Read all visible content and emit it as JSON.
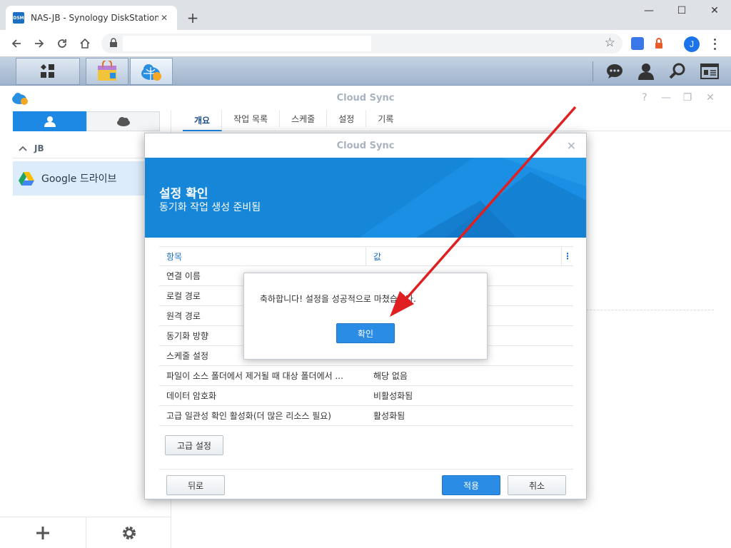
{
  "browser": {
    "tab_title": "NAS-JB - Synology DiskStation",
    "favicon_text": "DSM",
    "new_tab": "+",
    "avatar_letter": "J"
  },
  "app": {
    "title": "Cloud Sync",
    "sidebar": {
      "group_label": "JB",
      "item_label": "Google 드라이브"
    },
    "tabs": [
      "개요",
      "작업 목록",
      "스케줄",
      "설정",
      "기록"
    ]
  },
  "dialog": {
    "title": "Cloud Sync",
    "banner_title": "설정 확인",
    "banner_subtitle": "동기화 작업 생성 준비됨",
    "columns": {
      "item": "항목",
      "value": "값",
      "more": "⋮"
    },
    "rows": [
      {
        "item": "연결 이름",
        "value": ""
      },
      {
        "item": "로컬 경로",
        "value": ""
      },
      {
        "item": "원격 경로",
        "value": ""
      },
      {
        "item": "동기화 방향",
        "value": ""
      },
      {
        "item": "스케줄 설정",
        "value": ""
      },
      {
        "item": "파일이 소스 폴더에서 제거될 때 대상 폴더에서 ...",
        "value": "해당 없음"
      },
      {
        "item": "데이터 암호화",
        "value": "비활성화됨"
      },
      {
        "item": "고급 일관성 확인 활성화(더 많은 리소스 필요)",
        "value": "활성화됨"
      }
    ],
    "advanced_button": "고급 설정",
    "back_button": "뒤로",
    "apply_button": "적용",
    "cancel_button": "취소"
  },
  "message": {
    "text": "축하합니다! 설정을 성공적으로 마쳤습니다.",
    "ok_button": "확인"
  },
  "colors": {
    "accent": "#1686d9",
    "primary_button": "#2a8ce5",
    "annotation_arrow": "#e02020"
  }
}
